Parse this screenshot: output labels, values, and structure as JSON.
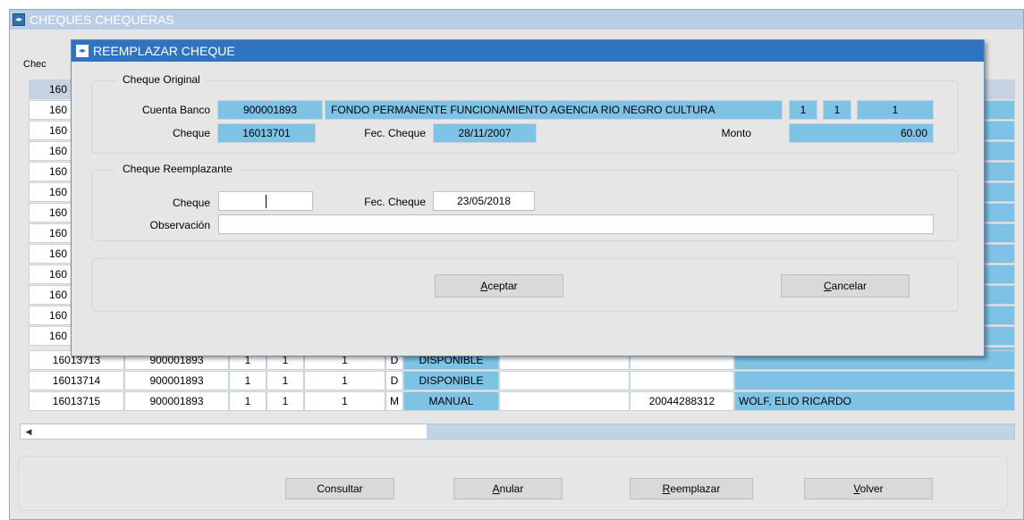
{
  "main_window": {
    "title": "CHEQUES CHEQUERAS",
    "icon": "app-icon"
  },
  "grid": {
    "header_fragment": "Chec",
    "visible_rows": [
      {
        "cheque": "16013713",
        "cuenta": "900001893",
        "c1": "1",
        "c2": "1",
        "c3": "1",
        "tipo": "D",
        "estado": "DISPONIBLE",
        "cuit": "",
        "nombre": ""
      },
      {
        "cheque": "16013714",
        "cuenta": "900001893",
        "c1": "1",
        "c2": "1",
        "c3": "1",
        "tipo": "D",
        "estado": "DISPONIBLE",
        "cuit": "",
        "nombre": ""
      },
      {
        "cheque": "16013715",
        "cuenta": "900001893",
        "c1": "1",
        "c2": "1",
        "c3": "1",
        "tipo": "M",
        "estado": "MANUAL",
        "cuit": "20044288312",
        "nombre": "WOLF, ELIO RICARDO"
      }
    ],
    "partial_row_prefix": "160"
  },
  "bottom_buttons": {
    "consultar": "Consultar",
    "anular_u": "A",
    "anular_rest": "nular",
    "reemplazar_u": "R",
    "reemplazar_rest": "eemplazar",
    "volver_u": "V",
    "volver_rest": "olver"
  },
  "modal": {
    "title": "REEMPLAZAR CHEQUE",
    "original": {
      "legend": "Cheque Original",
      "cuenta_label": "Cuenta Banco",
      "cuenta": "900001893",
      "descripcion": "FONDO PERMANENTE FUNCIONAMIENTO AGENCIA RIO NEGRO CULTURA",
      "f1": "1",
      "f2": "1",
      "f3": "1",
      "cheque_label": "Cheque",
      "cheque": "16013701",
      "fecha_label": "Fec. Cheque",
      "fecha": "28/11/2007",
      "monto_label": "Monto",
      "monto": "60.00"
    },
    "reemplazante": {
      "legend": "Cheque Reemplazante",
      "cheque_label": "Cheque",
      "cheque": "",
      "fecha_label": "Fec. Cheque",
      "fecha": "23/05/2018",
      "obs_label": "Observación",
      "obs": ""
    },
    "buttons": {
      "aceptar_u": "A",
      "aceptar_rest": "ceptar",
      "cancelar_u": "C",
      "cancelar_rest": "ancelar"
    }
  },
  "colors": {
    "field_blue": "#7ec3e6",
    "modal_title": "#2f74c0",
    "main_title": "#b9cde6"
  }
}
